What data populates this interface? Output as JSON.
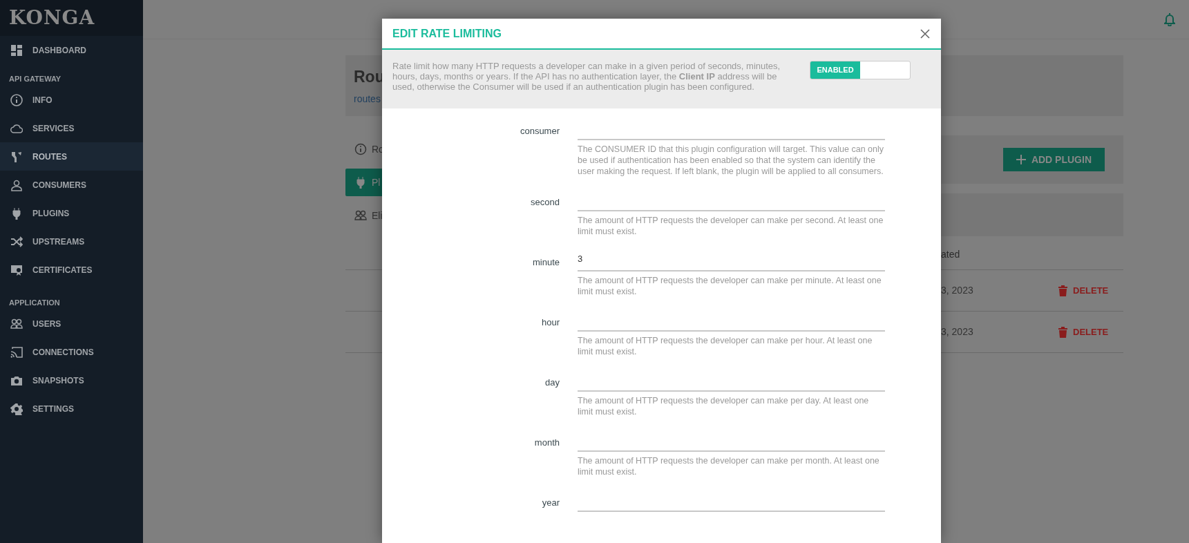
{
  "sidebar": {
    "logo": "KONGA",
    "items": [
      {
        "kind": "item",
        "label": "DASHBOARD",
        "selected": false
      },
      {
        "kind": "heading",
        "label": "API GATEWAY"
      },
      {
        "kind": "item",
        "label": "INFO",
        "selected": false
      },
      {
        "kind": "item",
        "label": "SERVICES",
        "selected": false
      },
      {
        "kind": "item",
        "label": "ROUTES",
        "selected": true
      },
      {
        "kind": "item",
        "label": "CONSUMERS",
        "selected": false
      },
      {
        "kind": "item",
        "label": "PLUGINS",
        "selected": false
      },
      {
        "kind": "item",
        "label": "UPSTREAMS",
        "selected": false
      },
      {
        "kind": "item",
        "label": "CERTIFICATES",
        "selected": false
      },
      {
        "kind": "heading",
        "label": "APPLICATION"
      },
      {
        "kind": "item",
        "label": "USERS",
        "selected": false
      },
      {
        "kind": "item",
        "label": "CONNECTIONS",
        "selected": false
      },
      {
        "kind": "item",
        "label": "SNAPSHOTS",
        "selected": false
      },
      {
        "kind": "item",
        "label": "SETTINGS",
        "selected": false
      }
    ]
  },
  "page": {
    "title": "Rou",
    "breadcrumb": "routes",
    "tabs": [
      {
        "label": "Ro",
        "selected": false
      },
      {
        "label": "Pl",
        "selected": true
      },
      {
        "label": "Eli",
        "selected": false
      }
    ],
    "add_button": "ADD PLUGIN",
    "table": {
      "column": "ated",
      "rows": [
        {
          "date": "3, 2023",
          "action": "DELETE"
        },
        {
          "date": "3, 2023",
          "action": "DELETE"
        }
      ]
    }
  },
  "modal": {
    "title": "EDIT RATE LIMITING",
    "description": "Rate limit how many HTTP requests a developer can make in a given period of seconds, minutes, hours, days, months or years. If the API has no authentication layer, the **Client IP** address will be used, otherwise the Consumer will be used if an authentication plugin has been configured.",
    "toggle": {
      "label": "ENABLED",
      "on": true
    },
    "fields": [
      {
        "label": "consumer",
        "help": "The CONSUMER ID that this plugin configuration will target. This value can only be used if authentication has been enabled so that the system can identify the user making the request. If left blank, the plugin will be applied to all consumers."
      },
      {
        "label": "second",
        "help": "The amount of HTTP requests the developer can make per second. At least one limit must exist."
      },
      {
        "label": "minute",
        "value": "3",
        "help": "The amount of HTTP requests the developer can make per minute. At least one limit must exist."
      },
      {
        "label": "hour",
        "help": "The amount of HTTP requests the developer can make per hour. At least one limit must exist."
      },
      {
        "label": "day",
        "help": "The amount of HTTP requests the developer can make per day. At least one limit must exist."
      },
      {
        "label": "month",
        "help": "The amount of HTTP requests the developer can make per month. At least one limit must exist."
      },
      {
        "label": "year"
      }
    ]
  }
}
